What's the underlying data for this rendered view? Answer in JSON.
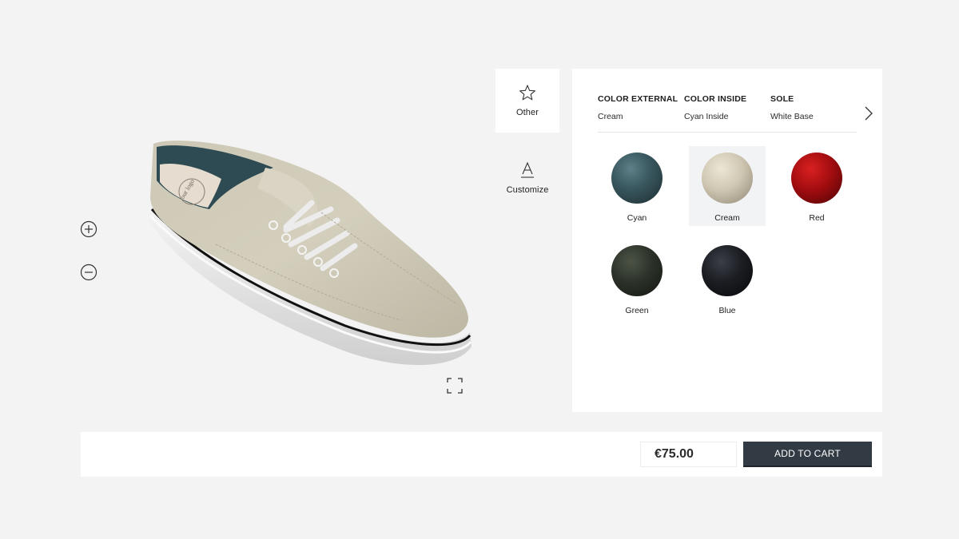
{
  "viewer": {
    "zoom_in_icon": "plus-circle-icon",
    "zoom_out_icon": "minus-circle-icon",
    "fullscreen_icon": "fullscreen-corners-icon",
    "insole_logo_text": "our logo"
  },
  "tabs": [
    {
      "label": "Other",
      "icon": "star-icon",
      "active": true
    },
    {
      "label": "Customize",
      "icon": "text-a-icon",
      "active": false
    }
  ],
  "attributes": [
    {
      "title": "COLOR EXTERNAL",
      "value": "Cream"
    },
    {
      "title": "COLOR INSIDE",
      "value": "Cyan Inside"
    },
    {
      "title": "SOLE",
      "value": "White Base"
    }
  ],
  "next_icon": "chevron-right-icon",
  "swatches": [
    {
      "label": "Cyan",
      "color": "#3a5960",
      "selected": false
    },
    {
      "label": "Cream",
      "color": "#cfc7b2",
      "selected": true
    },
    {
      "label": "Red",
      "color": "#a30d10",
      "selected": false
    },
    {
      "label": "Green",
      "color": "#2c3229",
      "selected": false
    },
    {
      "label": "Blue",
      "color": "#1b1d22",
      "selected": false
    }
  ],
  "cart": {
    "price": "€75.00",
    "button_label": "ADD TO CART",
    "button_color": "#323a43"
  }
}
